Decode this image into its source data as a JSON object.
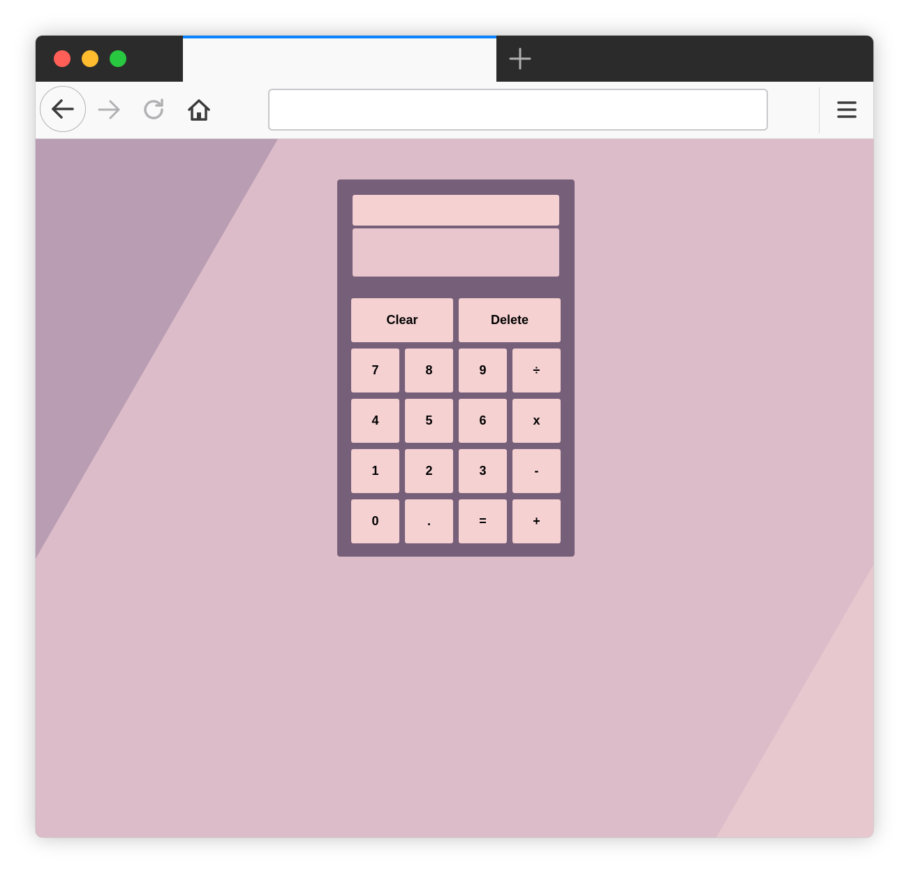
{
  "browser": {
    "tab_title": "",
    "url_value": "",
    "url_placeholder": "",
    "icons": {
      "close": "close-traffic-light",
      "minimize": "minimize-traffic-light",
      "maximize": "maximize-traffic-light",
      "new_tab": "plus-icon",
      "back": "arrow-left-icon",
      "forward": "arrow-right-icon",
      "reload": "reload-icon",
      "home": "home-icon",
      "menu": "hamburger-menu-icon"
    },
    "colors": {
      "close": "#ff5f57",
      "minimize": "#febc2e",
      "maximize": "#28c840",
      "tab_accent": "#0a84ff"
    }
  },
  "calculator": {
    "previous_operand": "",
    "current_operand": "",
    "keys": [
      {
        "label": "Clear",
        "wide": true,
        "name": "clear-button"
      },
      {
        "label": "Delete",
        "wide": true,
        "name": "delete-button"
      },
      {
        "label": "7",
        "name": "digit-7-button"
      },
      {
        "label": "8",
        "name": "digit-8-button"
      },
      {
        "label": "9",
        "name": "digit-9-button"
      },
      {
        "label": "÷",
        "name": "divide-button"
      },
      {
        "label": "4",
        "name": "digit-4-button"
      },
      {
        "label": "5",
        "name": "digit-5-button"
      },
      {
        "label": "6",
        "name": "digit-6-button"
      },
      {
        "label": "x",
        "name": "multiply-button"
      },
      {
        "label": "1",
        "name": "digit-1-button"
      },
      {
        "label": "2",
        "name": "digit-2-button"
      },
      {
        "label": "3",
        "name": "digit-3-button"
      },
      {
        "label": "-",
        "name": "subtract-button"
      },
      {
        "label": "0",
        "name": "digit-0-button"
      },
      {
        "label": ".",
        "name": "decimal-button"
      },
      {
        "label": "=",
        "name": "equals-button"
      },
      {
        "label": "+",
        "name": "add-button"
      }
    ],
    "colors": {
      "body": "#765f79",
      "key": "#f5d1d2",
      "page_background": "#dcbcc8"
    }
  }
}
